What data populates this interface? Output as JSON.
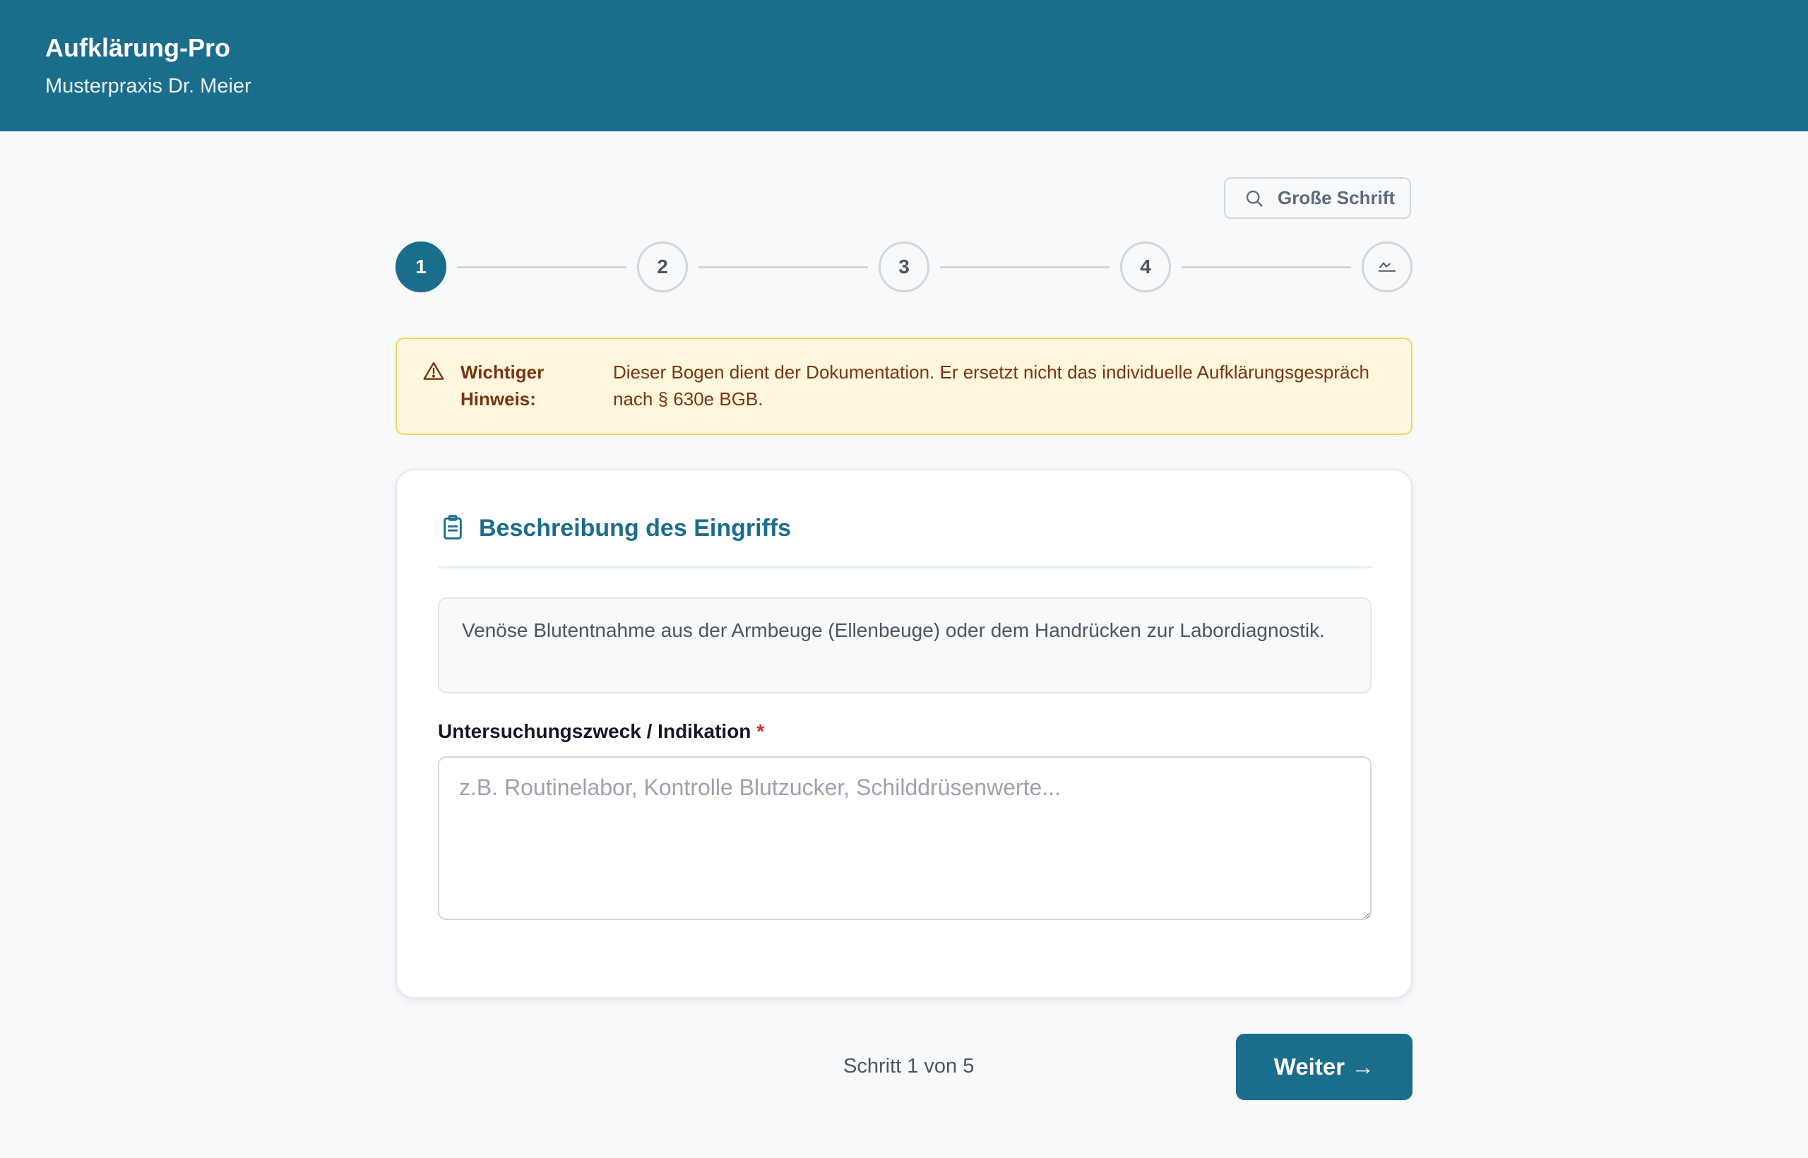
{
  "header": {
    "title": "Aufklärung-Pro",
    "subtitle": "Musterpraxis Dr. Meier"
  },
  "font_toggle": {
    "label": "Große Schrift",
    "icon": "search-icon"
  },
  "stepper": {
    "current_step": 1,
    "steps": [
      {
        "label": "1",
        "state": "active"
      },
      {
        "label": "2",
        "state": "inactive"
      },
      {
        "label": "3",
        "state": "inactive"
      },
      {
        "label": "4",
        "state": "inactive"
      },
      {
        "label": "",
        "icon": "signature-icon",
        "state": "inactive"
      }
    ]
  },
  "notice": {
    "icon": "warning-icon",
    "title": "Wichtiger Hinweis:",
    "text": "Dieser Bogen dient der Dokumentation. Er ersetzt nicht das individuelle Aufklärungsgespräch nach § 630e BGB."
  },
  "section": {
    "icon": "clipboard-icon",
    "title": "Beschreibung des Eingriffs",
    "description": "Venöse Blutentnahme aus der Armbeuge (Ellenbeuge) oder dem Handrücken zur Labordiagnostik."
  },
  "indication_field": {
    "label": "Untersuchungszweck / Indikation",
    "required_marker": "*",
    "value": "",
    "placeholder": "z.B. Routinelabor, Kontrolle Blutzucker, Schilddrüsenwerte..."
  },
  "footer": {
    "progress": "Schritt 1 von 5",
    "next_label": "Weiter →"
  },
  "colors": {
    "primary": "#1b6d8c",
    "notice_background": "#fef7de",
    "notice_border": "#f4d365",
    "notice_text": "#7a3410",
    "required": "#dc2626",
    "page_background": "#f7f9fb"
  }
}
